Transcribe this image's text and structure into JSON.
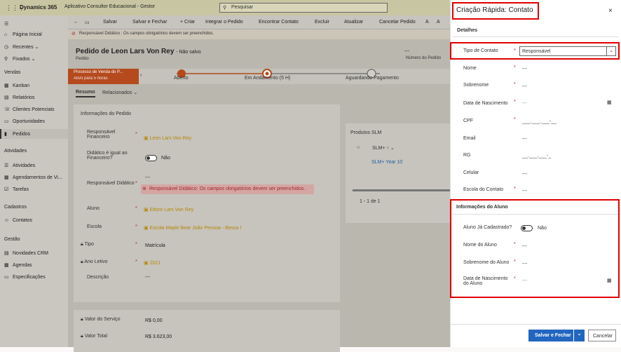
{
  "header": {
    "waffle": "⋮⋮⋮",
    "brand": "Dynamics 365",
    "app": "Aplicativo Consultor Educacional - Gestor",
    "search_placeholder": "Pesquisar"
  },
  "sidebar": {
    "items": [
      {
        "icon": "⌂",
        "label": "Página Inicial"
      },
      {
        "icon": "◷",
        "label": "Recentes"
      },
      {
        "icon": "⚲",
        "label": "Fixados"
      }
    ],
    "sections": [
      {
        "title": "Vendas",
        "items": [
          "Kanban",
          "Relatórios",
          "Clientes Potenciais",
          "Oportunidades",
          "Pedidos"
        ]
      },
      {
        "title": "Atividades",
        "items": [
          "Atividades",
          "Agendamentos de Vi...",
          "Tarefas"
        ]
      },
      {
        "title": "Cadastros",
        "items": [
          "Contatos"
        ]
      },
      {
        "title": "Gestão",
        "items": [
          "Novidades CRM",
          "Agendas",
          "Especificações"
        ]
      }
    ],
    "chevron": "⌄"
  },
  "commandbar": {
    "items": [
      "Salvar",
      "Salvar e Fechar",
      "+ Criar",
      "Integrar o Pedido",
      "Encontrar Contato",
      "Excluir",
      "Atualizar",
      "Cancelar Pedido",
      "A",
      "A"
    ]
  },
  "warning": "Responsável Didático : Os campos obrigatórios devem ser preenchidos.",
  "record": {
    "title": "Pedido de Leon Lars Von Rey",
    "status": "- Não salvo",
    "entity": "Pedido",
    "number_value": "---",
    "number_label": "Número do Pedido"
  },
  "bpf": {
    "stage_name": "Processo de Venda do P...",
    "stage_time": "Ativo para 5 horas",
    "steps": [
      "Aberto",
      "Em Andamento  (5 H)",
      "Aguardando Pagamento"
    ]
  },
  "tabs": [
    "Resumo",
    "Relacionados ⌄"
  ],
  "order_info": {
    "title": "Informações do Pedido",
    "fields": [
      {
        "label": "Responsável Financeiro",
        "value": "Leon Lars Von Rey"
      },
      {
        "label": "Didático é igual ao Financeiro?",
        "value": "Não"
      },
      {
        "label": "Responsável Didático",
        "value": "---"
      },
      {
        "label": "Aluno",
        "value": "Ettore Lars Von Rey"
      },
      {
        "label": "Escola",
        "value": "Escola Maple Bear João Pessoa - Bessa I"
      },
      {
        "label": "Tipo",
        "value": "Matrícula"
      },
      {
        "label": "Ano Letivo",
        "value": "2021"
      },
      {
        "label": "Descrição",
        "value": "---"
      }
    ],
    "error": "Responsável Didático: Os campos obrigatórios devem ser preenchidos."
  },
  "products": {
    "title": "Produtos SLM",
    "col": "SLM+ ↑ ⌄",
    "row": "SLM+ Year 10",
    "pager": "1 - 1 de 1"
  },
  "totals": [
    {
      "label": "Valor do Serviço",
      "value": "R$ 0,00"
    },
    {
      "label": "Valor Total",
      "value": "R$ 3.623,00"
    }
  ],
  "quick_create": {
    "title": "Criação Rápida: Contato",
    "close": "×",
    "section1": "Detalhes",
    "fields": [
      {
        "label": "Tipo de Contato",
        "value": "Responsável",
        "req": "*"
      },
      {
        "label": "Nome",
        "value": "---",
        "req": "*"
      },
      {
        "label": "Sobrenome",
        "value": "---",
        "req": "*"
      },
      {
        "label": "Data de Nascimento",
        "value": "---",
        "req": "*"
      },
      {
        "label": "CPF",
        "value": "___.___.___-__",
        "req": "*"
      },
      {
        "label": "Email",
        "value": "---",
        "req": ""
      },
      {
        "label": "RG",
        "value": "__.___.___-_",
        "req": ""
      },
      {
        "label": "Celular",
        "value": "---",
        "req": ""
      },
      {
        "label": "Escola do Contato",
        "value": "---",
        "req": "*"
      }
    ],
    "section2": "Informações do Aluno",
    "student": [
      {
        "label": "Aluno Já Cadastrado?",
        "value": "Não",
        "req": ""
      },
      {
        "label": "Nome do Aluno",
        "value": "---",
        "req": "*"
      },
      {
        "label": "Sobrenome do Aluno",
        "value": "---",
        "req": "*"
      },
      {
        "label": "Data de Nascimento do Aluno",
        "value": "---",
        "req": "*"
      }
    ],
    "save_btn": "Salvar e Fechar",
    "save_chevron": "⌄",
    "cancel_btn": "Cancelar"
  },
  "colors": {
    "accent": "#2266c1",
    "error": "#a4262c",
    "highlight": "#e00000",
    "stage": "#b44a1e"
  }
}
